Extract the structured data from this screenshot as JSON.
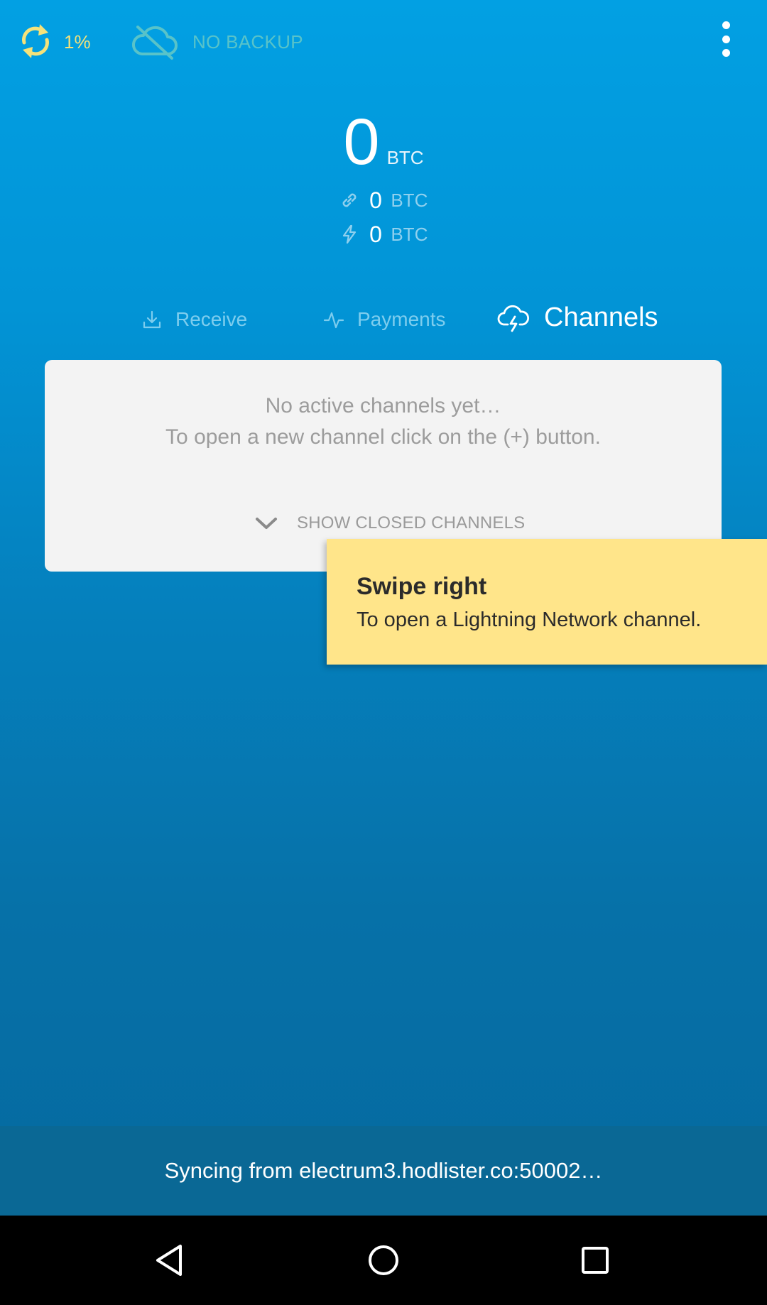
{
  "topbar": {
    "sync_percent": "1%",
    "backup_status": "NO BACKUP",
    "sync_icon": "sync-icon",
    "cloud_icon": "cloud-off-icon",
    "menu_icon": "more-vert-icon"
  },
  "balance": {
    "total_amount": "0",
    "total_unit": "BTC",
    "onchain_amount": "0",
    "onchain_unit": "BTC",
    "onchain_icon": "link-icon",
    "lightning_amount": "0",
    "lightning_unit": "BTC",
    "lightning_icon": "lightning-bolt-icon"
  },
  "tabs": [
    {
      "label": "Receive",
      "icon": "download-icon",
      "active": false
    },
    {
      "label": "Payments",
      "icon": "activity-icon",
      "active": false
    },
    {
      "label": "Channels",
      "icon": "cloud-lightning-icon",
      "active": true
    }
  ],
  "channels_card": {
    "empty_title": "No active channels yet…",
    "empty_hint": "To open a new channel click on the (+) button.",
    "show_closed_label": "SHOW CLOSED CHANNELS"
  },
  "tooltip": {
    "title": "Swipe right",
    "body": "To open a Lightning Network channel."
  },
  "status": {
    "text": "Syncing from electrum3.hodlister.co:50002…"
  },
  "navbar": {
    "back_icon": "back-triangle-icon",
    "home_icon": "home-circle-icon",
    "recents_icon": "recents-square-icon"
  },
  "colors": {
    "background_top": "#02a0e3",
    "background_bottom": "#056aa0",
    "sync_yellow": "#f5e27a",
    "no_backup_teal": "#58c3c9",
    "tooltip_yellow": "#ffe58a",
    "card_bg": "#f3f3f3",
    "status_bar": "#0a6895"
  }
}
